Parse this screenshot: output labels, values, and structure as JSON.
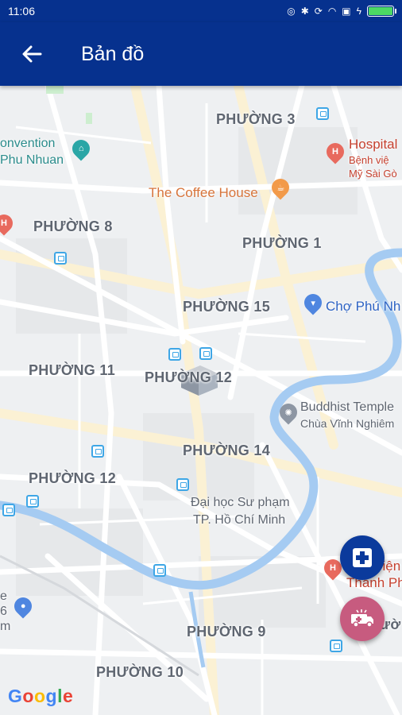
{
  "status_bar": {
    "time": "11:06"
  },
  "app_bar": {
    "title": "Bản đồ"
  },
  "map": {
    "wards": {
      "phuong_3": "PHƯỜNG 3",
      "phuong_8": "PHƯỜNG 8",
      "phuong_1": "PHƯỜNG 1",
      "phuong_15": "PHƯỜNG 15",
      "phuong_11": "PHƯỜNG 11",
      "phuong_12a": "PHƯỜNG 12",
      "phuong_14": "PHƯỜNG 14",
      "phuong_12b": "PHƯỜNG 12",
      "phuong_9": "PHƯỜNG 9",
      "phuong_10": "PHƯỜNG 10"
    },
    "pois": {
      "convention": "onvention",
      "phu_nhuan": "Phu Nhuan",
      "coffee_house": "The Coffee House",
      "hospital_top": "Hospital",
      "hospital_top_sub1": "Bệnh việ",
      "hospital_top_sub2": "Mỹ Sài Gò",
      "cho_phu_nhuan": "Chợ Phú Nh",
      "buddhist_temple": "Buddhist Temple",
      "chua_vinh_nghiem": "Chùa Vĩnh Nghiêm",
      "dai_hoc_1": "Đại học Sư phạm",
      "dai_hoc_2": "TP. Hồ Chí Minh",
      "hospital_bottom_1": "viện",
      "hospital_bottom_2": "Thanh Ph",
      "phuong_fragment": "ườ",
      "edge_e": "e",
      "edge_6": "6",
      "edge_m": "m"
    },
    "google_logo": {
      "g1": "G",
      "g2": "o",
      "g3": "o",
      "g4": "g",
      "g5": "l",
      "g6": "e"
    }
  },
  "actions": {
    "hospital_icon": "hospital-plus-icon",
    "ambulance_icon": "ambulance-icon"
  },
  "colors": {
    "app_bar": "#06318e",
    "river": "#a5cbf2",
    "fab_hospital": "#0b3a9c",
    "fab_ambulance": "#c75b7f"
  }
}
